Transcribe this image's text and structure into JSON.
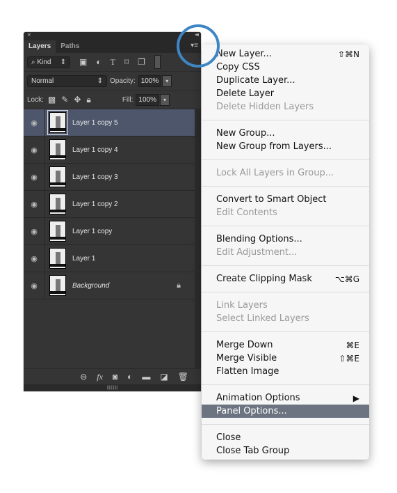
{
  "panel": {
    "close_glyph": "×",
    "collapse_glyph": "◂◂",
    "tabs": [
      {
        "label": "Layers",
        "active": true
      },
      {
        "label": "Paths",
        "active": false
      }
    ],
    "menu_icon": "panel-menu-icon",
    "filter": {
      "label": "Kind",
      "icons": [
        "image-filter-icon",
        "adjustment-filter-icon",
        "type-filter-icon",
        "shape-filter-icon",
        "smart-object-filter-icon",
        "filter-toggle-icon"
      ]
    },
    "blend_mode": "Normal",
    "opacity_label": "Opacity:",
    "opacity_value": "100%",
    "lock_label": "Lock:",
    "fill_label": "Fill:",
    "fill_value": "100%",
    "layers": [
      {
        "name": "Layer 1 copy 5",
        "visible": true,
        "selected": true
      },
      {
        "name": "Layer 1 copy 4",
        "visible": true
      },
      {
        "name": "Layer 1 copy 3",
        "visible": true
      },
      {
        "name": "Layer 1 copy 2",
        "visible": true
      },
      {
        "name": "Layer 1 copy",
        "visible": true
      },
      {
        "name": "Layer 1",
        "visible": true
      },
      {
        "name": "Background",
        "visible": true,
        "locked": true
      }
    ],
    "footer_icons": [
      "link-icon",
      "fx-icon",
      "mask-icon",
      "adjustment-icon",
      "group-folder-icon",
      "new-layer-icon",
      "trash-icon"
    ]
  },
  "menu": {
    "groups": [
      [
        {
          "label": "New Layer...",
          "shortcut": "⇧⌘N"
        },
        {
          "label": "Copy CSS"
        },
        {
          "label": "Duplicate Layer..."
        },
        {
          "label": "Delete Layer"
        },
        {
          "label": "Delete Hidden Layers",
          "disabled": true
        }
      ],
      [
        {
          "label": "New Group..."
        },
        {
          "label": "New Group from Layers..."
        }
      ],
      [
        {
          "label": "Lock All Layers in Group...",
          "disabled": true
        }
      ],
      [
        {
          "label": "Convert to Smart Object"
        },
        {
          "label": "Edit Contents",
          "disabled": true
        }
      ],
      [
        {
          "label": "Blending Options..."
        },
        {
          "label": "Edit Adjustment...",
          "disabled": true
        }
      ],
      [
        {
          "label": "Create Clipping Mask",
          "shortcut": "⌥⌘G"
        }
      ],
      [
        {
          "label": "Link Layers",
          "disabled": true
        },
        {
          "label": "Select Linked Layers",
          "disabled": true
        }
      ],
      [
        {
          "label": "Merge Down",
          "shortcut": "⌘E"
        },
        {
          "label": "Merge Visible",
          "shortcut": "⇧⌘E"
        },
        {
          "label": "Flatten Image"
        }
      ],
      [
        {
          "label": "Animation Options",
          "shortcut": "▶"
        },
        {
          "label": "Panel Options...",
          "highlighted": true
        }
      ],
      [
        {
          "label": "Close"
        },
        {
          "label": "Close Tab Group"
        }
      ]
    ]
  },
  "highlight_color": "#3e86c4"
}
